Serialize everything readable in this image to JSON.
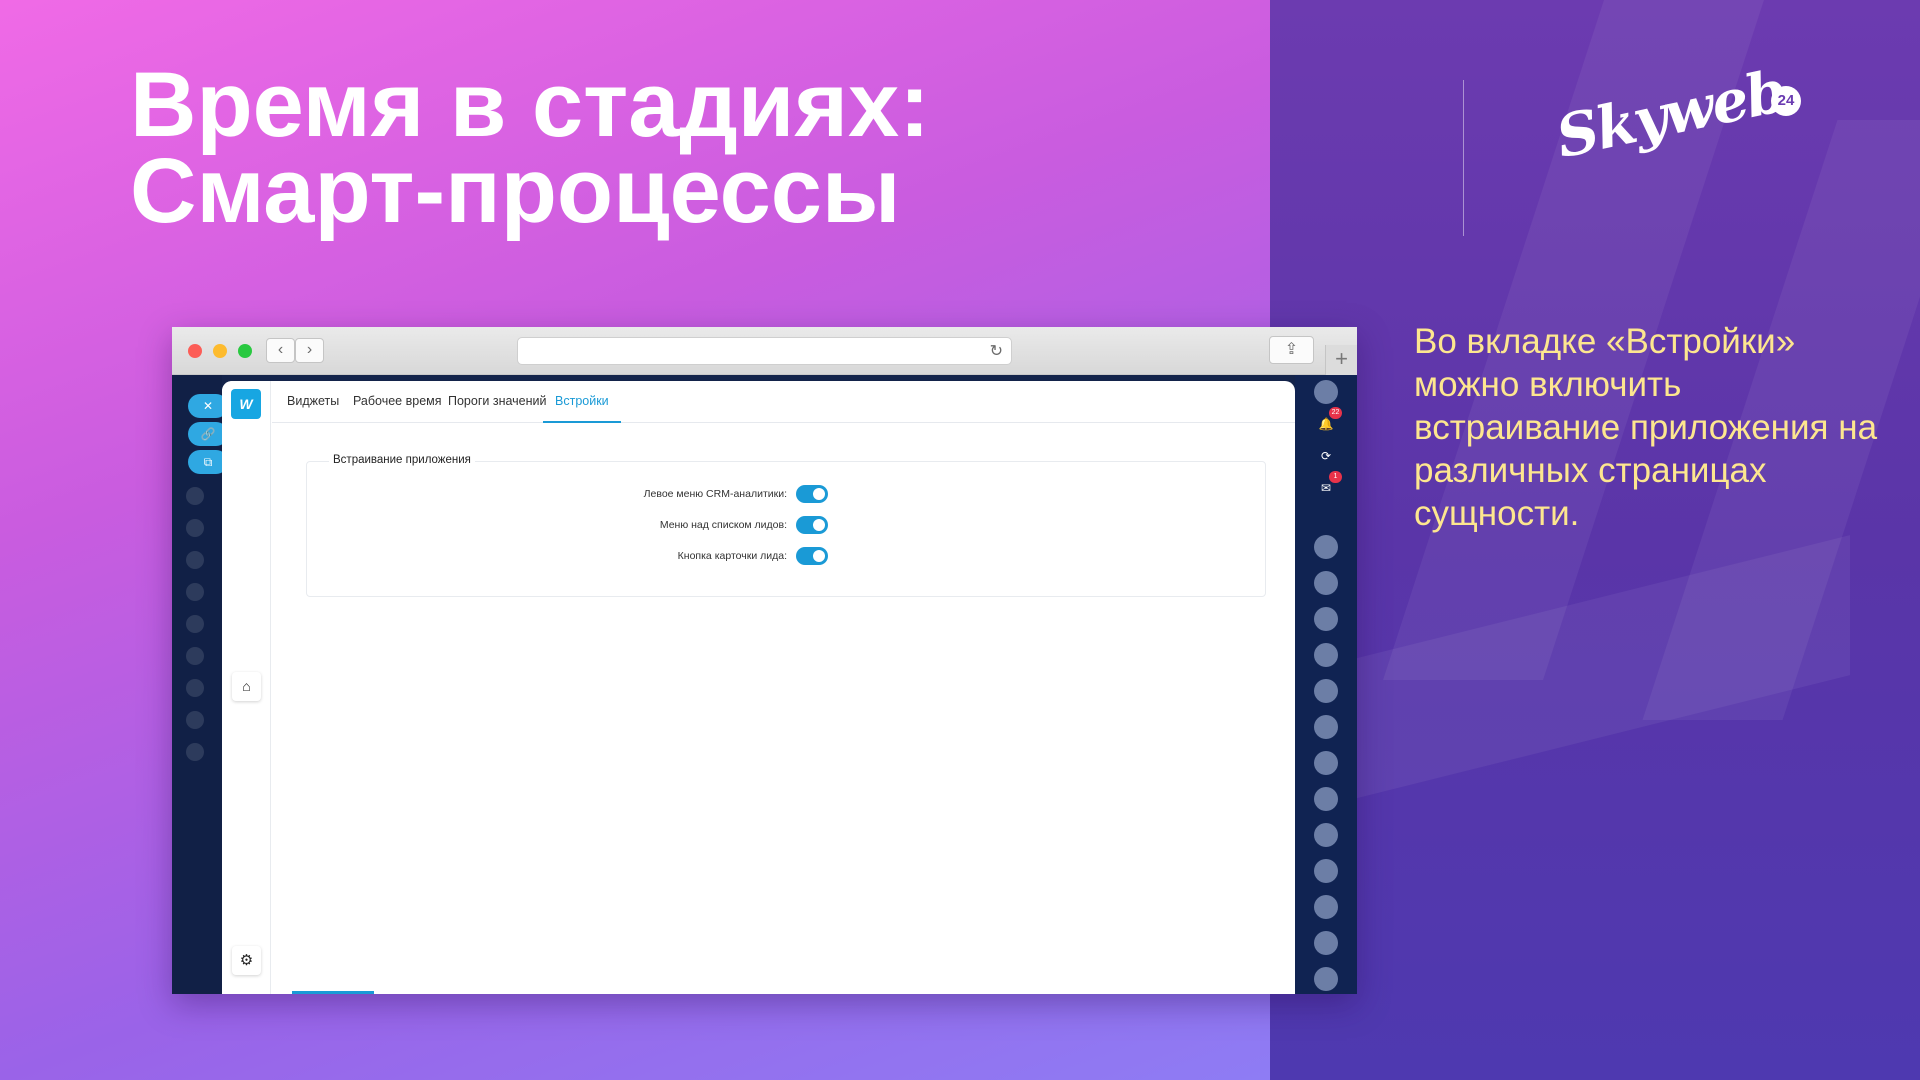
{
  "slide": {
    "title_line1": "Время в стадиях:",
    "title_line2": "Смарт-процессы",
    "description": "Во вкладке «Встройки» можно включить встраивание приложения на различных страницах сущности.",
    "logo": {
      "text": "Skyweb",
      "badge": "24"
    },
    "colors": {
      "accent": "#1a9ad6",
      "description_text": "#fde68f",
      "left_bg": "#c95cdf",
      "right_bg": "#5a35a8"
    }
  },
  "browser": {
    "icons": {
      "back": "chevron-left-icon",
      "forward": "chevron-right-icon",
      "reload": "reload-icon",
      "share": "share-icon",
      "new_tab": "plus-icon"
    },
    "app": {
      "nav_icons": {
        "logo": "app-logo-icon",
        "home": "home-icon",
        "settings": "gear-icon"
      },
      "tabs": [
        {
          "label": "Виджеты"
        },
        {
          "label": "Рабочее время"
        },
        {
          "label": "Пороги значений"
        },
        {
          "label": "Встройки"
        }
      ],
      "active_tab": "Встройки",
      "section": {
        "title": "Встраивание приложения",
        "rows": [
          {
            "label": "Левое меню CRM-аналитики:",
            "enabled": true
          },
          {
            "label": "Меню над списком лидов:",
            "enabled": true
          },
          {
            "label": "Кнопка карточки лида:",
            "enabled": true
          }
        ]
      }
    },
    "portal_right": {
      "badges": [
        "22",
        "1"
      ]
    }
  }
}
